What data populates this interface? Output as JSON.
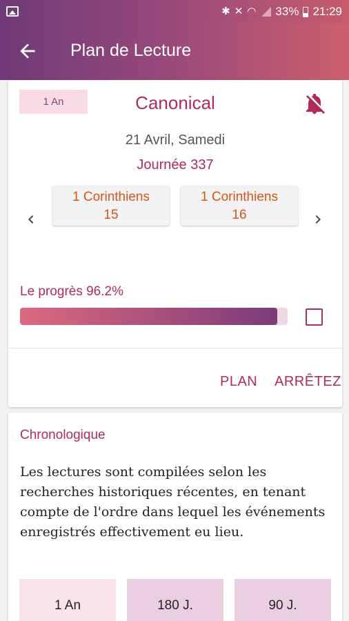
{
  "status": {
    "battery": "33%",
    "time": "21:29"
  },
  "appbar": {
    "title": "Plan de Lecture"
  },
  "plan": {
    "badge": "1 An",
    "name": "Canonical",
    "date": "21 Avril, Samedi",
    "day": "Journée 337",
    "chapters": [
      {
        "book": "1 Corinthiens",
        "chapter": "15"
      },
      {
        "book": "1 Corinthiens",
        "chapter": "16"
      }
    ],
    "progress_label": "Le progrès 96.2%",
    "progress": 0.962
  },
  "actions": {
    "plan": "PLAN",
    "stop": "ARRÊTEZ"
  },
  "chrono": {
    "title": "Chronologique",
    "description": "Les lectures sont compilées selon les recherches historiques récentes, en tenant compte de l'ordre dans lequel les événements enregistrés effectivement eu lieu.",
    "durations": [
      "1 An",
      "180 J.",
      "90 J."
    ]
  },
  "colors": {
    "accent": "#b12b57",
    "chapter_text": "#d4561a"
  }
}
